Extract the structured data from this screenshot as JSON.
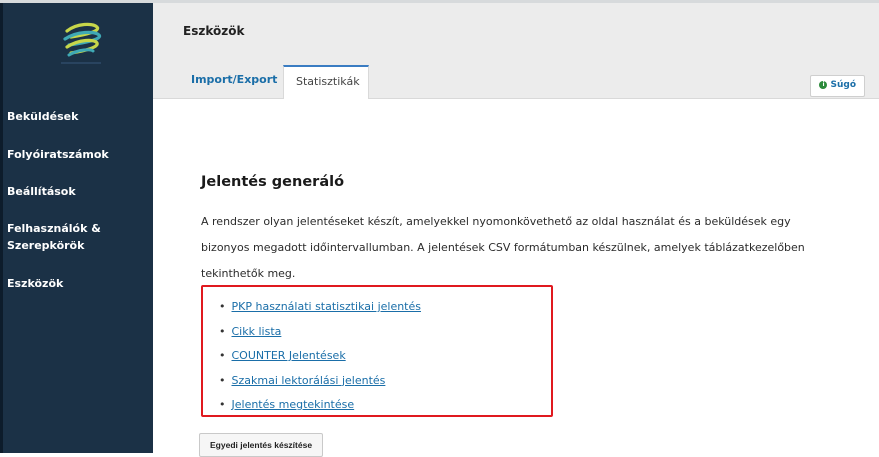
{
  "sidebar": {
    "items": [
      {
        "label": "Beküldések"
      },
      {
        "label": "Folyóiratszámok"
      },
      {
        "label": "Beállítások"
      },
      {
        "label": "Felhasználók &\nSzerepkörök"
      },
      {
        "label": "Eszközök"
      }
    ]
  },
  "header": {
    "title": "Eszközök",
    "tabs": [
      {
        "label": "Import/Export"
      },
      {
        "label": "Statisztikák"
      }
    ],
    "help_label": "Súgó",
    "help_icon": "info-icon"
  },
  "main": {
    "title": "Jelentés generáló",
    "description": "A rendszer olyan jelentéseket készít, amelyekkel nyomonkövethető az oldal használat és a beküldések egy bizonyos megadott időintervallumban. A jelentések CSV formátumban készülnek, amelyek táblázatkezelőben tekinthetők meg.",
    "reports": [
      {
        "label": "PKP használati statisztikai jelentés"
      },
      {
        "label": "Cikk lista"
      },
      {
        "label": "COUNTER Jelentések"
      },
      {
        "label": "Szakmai lektorálási jelentés"
      },
      {
        "label": "Jelentés megtekintése"
      }
    ],
    "custom_report_button": "Egyedi jelentés készítése"
  },
  "colors": {
    "sidebar_bg": "#1b3146",
    "link": "#1a6ea8",
    "highlight_border": "#e0191f",
    "tab_active_border": "#3a7cc2"
  }
}
